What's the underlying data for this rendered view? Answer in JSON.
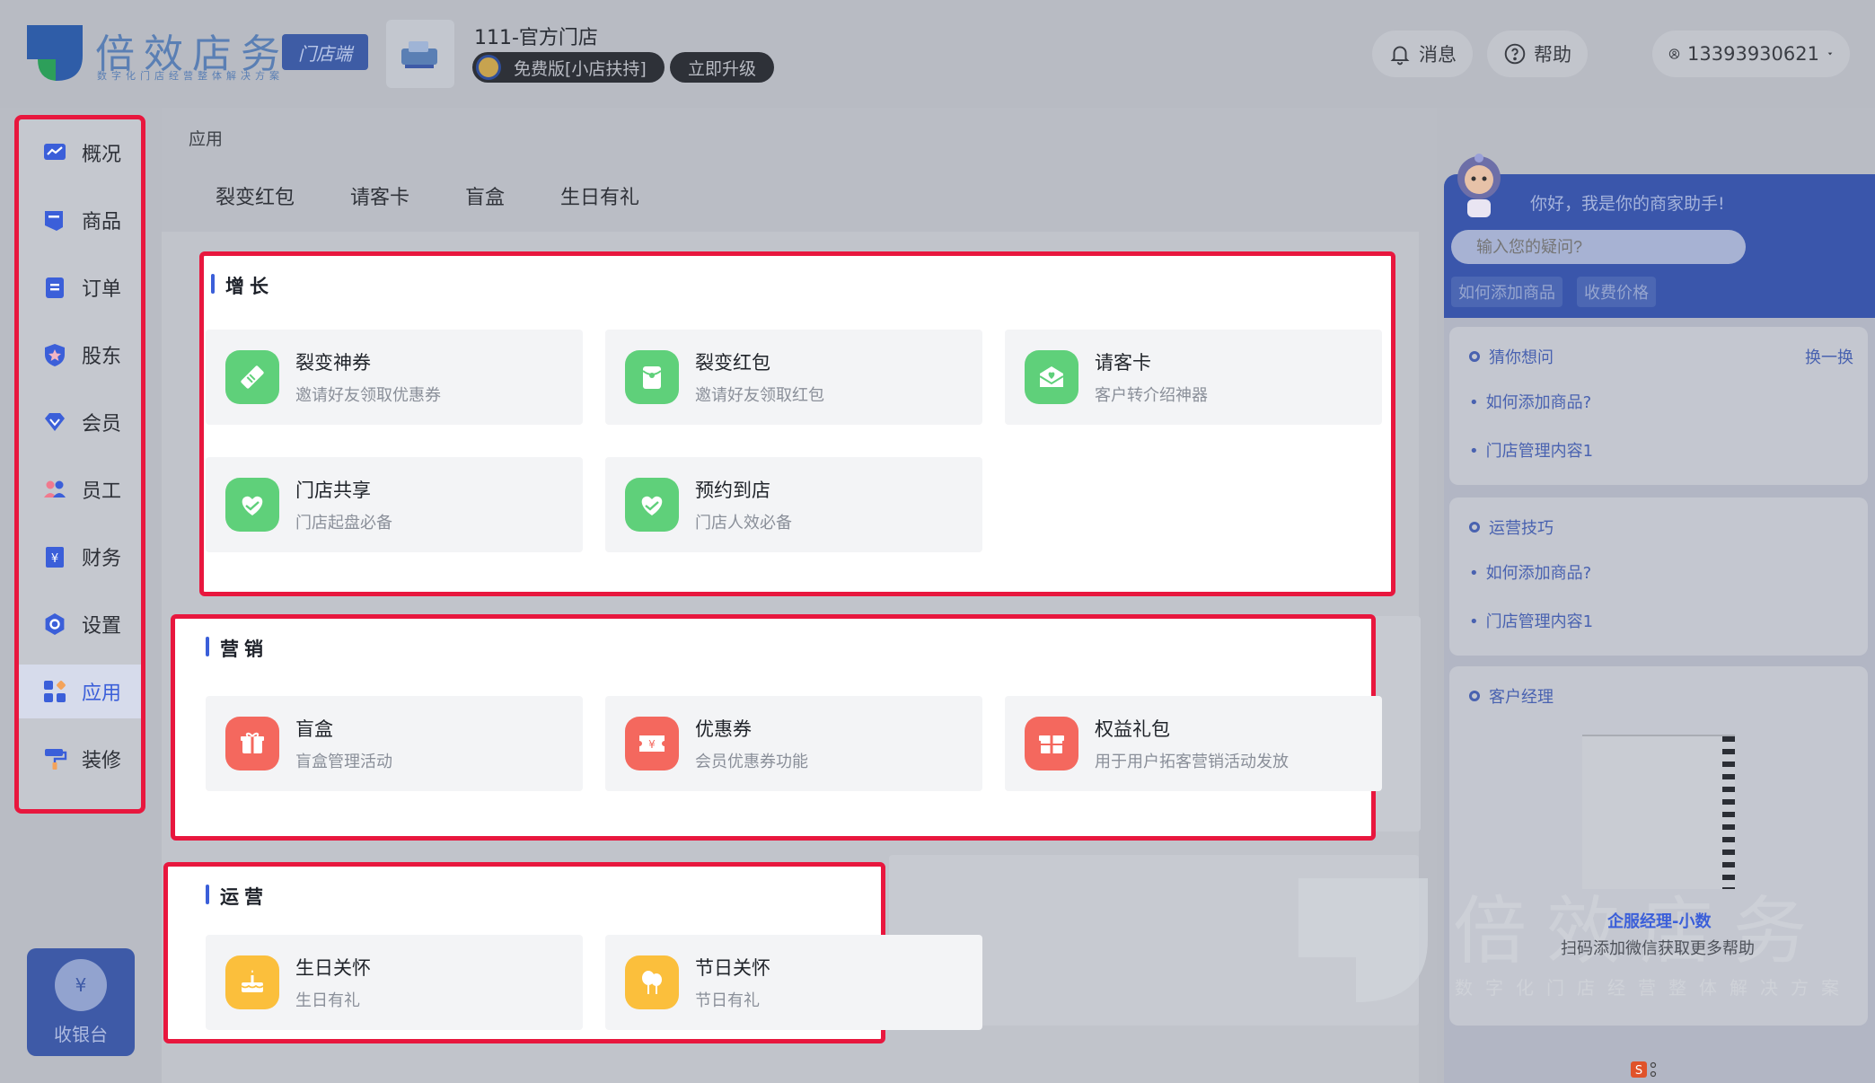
{
  "header": {
    "logo_text": "倍效店务",
    "logo_sub": "数字化门店经营整体解决方案",
    "store_tag": "门店端",
    "store_name": "111-官方门店",
    "plan": "免费版[小店扶持]",
    "upgrade": "立即升级",
    "messages": "消息",
    "help": "帮助",
    "account": "13393930621"
  },
  "sidebar": {
    "items": [
      {
        "label": "概况",
        "icon": "overview-icon"
      },
      {
        "label": "商品",
        "icon": "goods-icon"
      },
      {
        "label": "订单",
        "icon": "order-icon"
      },
      {
        "label": "股东",
        "icon": "shareholder-icon"
      },
      {
        "label": "会员",
        "icon": "member-icon"
      },
      {
        "label": "员工",
        "icon": "staff-icon"
      },
      {
        "label": "财务",
        "icon": "finance-icon"
      },
      {
        "label": "设置",
        "icon": "settings-icon"
      },
      {
        "label": "应用",
        "icon": "apps-icon",
        "active": true
      },
      {
        "label": "装修",
        "icon": "decorate-icon"
      }
    ],
    "cashier": "收银台"
  },
  "main": {
    "breadcrumb": "应用",
    "tabs": [
      "裂变红包",
      "请客卡",
      "盲盒",
      "生日有礼"
    ],
    "sections": [
      {
        "title": "增长",
        "cards": [
          {
            "title": "裂变神券",
            "desc": "邀请好友领取优惠券",
            "icon": "coupon-icon"
          },
          {
            "title": "裂变红包",
            "desc": "邀请好友领取红包",
            "icon": "red-envelope-icon"
          },
          {
            "title": "请客卡",
            "desc": "客户转介绍神器",
            "icon": "mail-heart-icon"
          },
          {
            "title": "门店共享",
            "desc": "门店起盘必备",
            "icon": "heart-hands-icon"
          },
          {
            "title": "预约到店",
            "desc": "门店人效必备",
            "icon": "heart-hands-icon"
          }
        ]
      },
      {
        "title": "营销",
        "cards": [
          {
            "title": "盲盒",
            "desc": "盲盒管理活动",
            "icon": "gift-box-icon"
          },
          {
            "title": "优惠券",
            "desc": "会员优惠券功能",
            "icon": "yen-ticket-icon"
          },
          {
            "title": "权益礼包",
            "desc": "用于用户拓客营销活动发放",
            "icon": "gift-pack-icon"
          }
        ]
      },
      {
        "title": "运营",
        "cards": [
          {
            "title": "生日关怀",
            "desc": "生日有礼",
            "icon": "cake-icon"
          },
          {
            "title": "节日关怀",
            "desc": "节日有礼",
            "icon": "balloon-icon"
          }
        ]
      }
    ]
  },
  "assistant": {
    "greeting": "你好，我是你的商家助手!",
    "input_placeholder": "输入您的疑问?",
    "quick_tags": [
      "如何添加商品",
      "收费价格"
    ],
    "guess": {
      "title": "猜你想问",
      "swap": "换一换",
      "links": [
        "如何添加商品?",
        "门店管理内容1"
      ]
    },
    "tips": {
      "title": "运营技巧",
      "links": [
        "如何添加商品?",
        "门店管理内容1"
      ]
    },
    "manager": {
      "title": "客户经理",
      "name": "企服经理-小数",
      "tip": "扫码添加微信获取更多帮助"
    },
    "watermark": "倍效店务",
    "watermark_sub": "数字化门店经营整体解决方案"
  },
  "colors": {
    "accent": "#3b5fd9",
    "highlight_border": "#e8173e",
    "green": "#5fd07a",
    "red": "#f4685e",
    "yellow": "#fbbf3c"
  }
}
